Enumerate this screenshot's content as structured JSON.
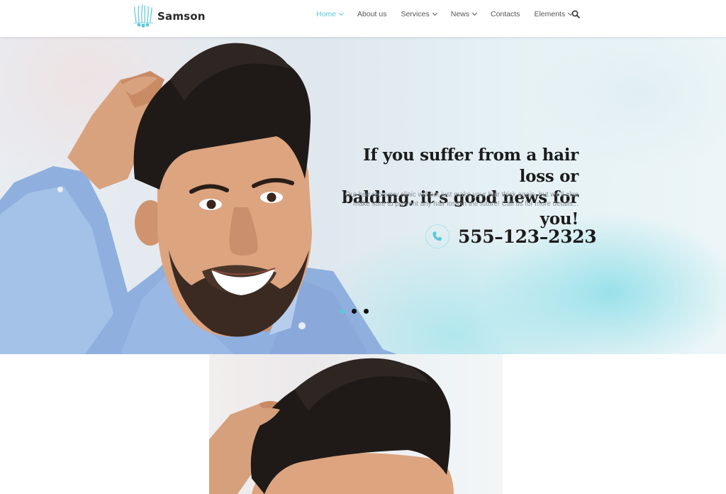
{
  "brand": {
    "name": "Samson",
    "accent_color": "#5bc8d8"
  },
  "nav": {
    "items": [
      {
        "label": "Home",
        "active": true,
        "has_dropdown": true
      },
      {
        "label": "About us",
        "active": false,
        "has_dropdown": false
      },
      {
        "label": "Services",
        "active": false,
        "has_dropdown": true
      },
      {
        "label": "News",
        "active": false,
        "has_dropdown": true
      },
      {
        "label": "Contacts",
        "active": false,
        "has_dropdown": false
      },
      {
        "label": "Elements",
        "active": false,
        "has_dropdown": true
      }
    ],
    "search_icon": "search-icon"
  },
  "hero": {
    "title_line1": "If you suffer from a hair loss or",
    "title_line2": "balding, it’s good news for you!",
    "subtitle_line1": "Our hair recovery clinic will not just make your hair thick again, but we’ll also",
    "subtitle_line2": "make sure to prevent any hair loss in the future!  Call us for more details...",
    "phone_icon": "phone-icon",
    "phone_number": "555–123–2323",
    "slides": 3,
    "active_slide": 1
  },
  "section2": {
    "image": "smiling-man-with-dark-hair-photo"
  }
}
